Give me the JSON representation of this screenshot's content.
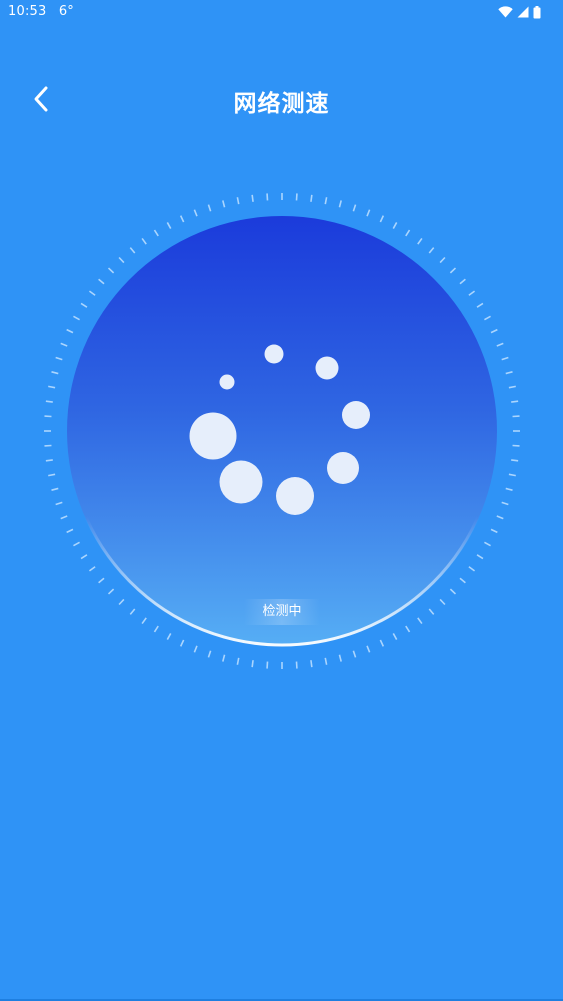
{
  "status_bar": {
    "time": "10:53",
    "temperature": "6°",
    "icons": [
      "wifi-icon",
      "cell-signal-icon",
      "battery-icon"
    ]
  },
  "header": {
    "back_icon": "chevron-left-icon",
    "title": "网络测速"
  },
  "gauge": {
    "status_text": "检测中"
  },
  "colors": {
    "background": "#2f93f6",
    "circle_top": "#1c3fdc",
    "circle_bottom": "#4fa8f4",
    "tick": "#bfe0ff",
    "loader_dot": "#e6eefb"
  }
}
